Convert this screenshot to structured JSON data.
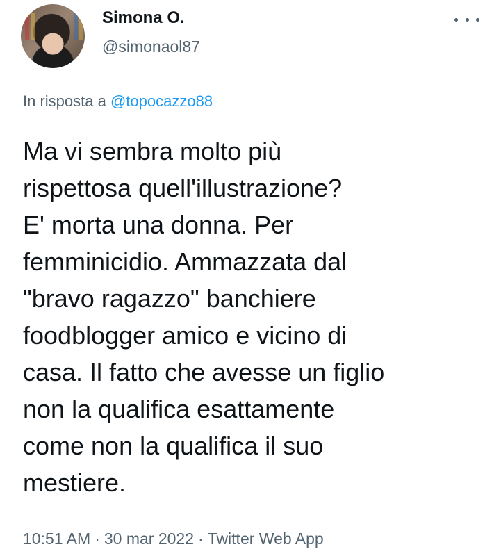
{
  "tweet": {
    "author": {
      "name": "Simona O.",
      "handle": "@simonaol87"
    },
    "reply_prefix": "In risposta a",
    "reply_to": "@topocazzo88",
    "text": "Ma vi sembra molto più\nrispettosa quell'illustrazione?\nE' morta una donna. Per\nfemminicidio. Ammazzata dal\n\"bravo ragazzo\" banchiere\nfoodblogger amico e vicino di\ncasa. Il fatto che avesse un figlio\nnon la qualifica esattamente\ncome non la qualifica il suo\nmestiere.",
    "time": "10:51 AM",
    "date": "30 mar 2022",
    "source": "Twitter Web App",
    "separator": "·"
  }
}
